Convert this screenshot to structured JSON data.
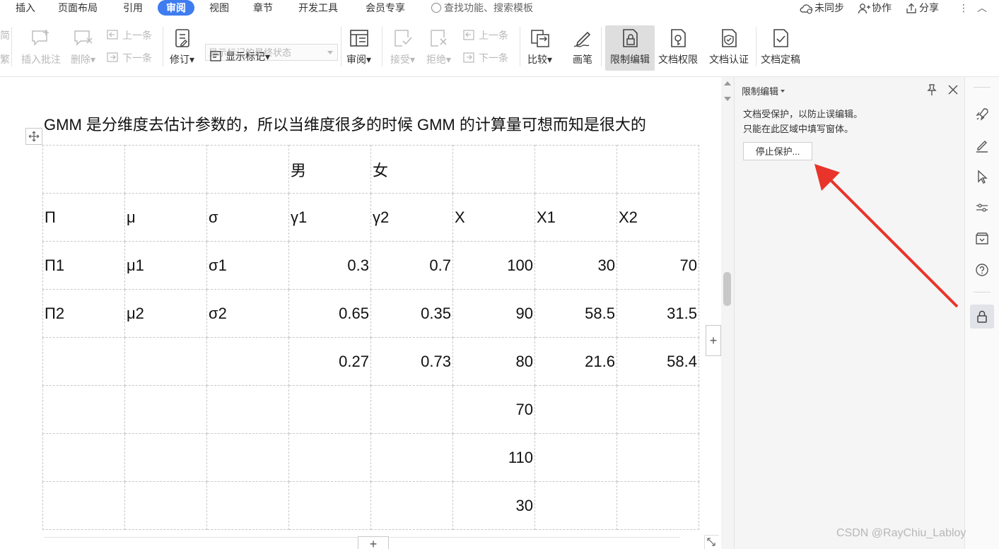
{
  "menu": {
    "tabs": [
      "插入",
      "页面布局",
      "引用",
      "审阅",
      "视图",
      "章节",
      "开发工具",
      "会员专享"
    ],
    "active_tab": "审阅",
    "search_placeholder": "查找功能、搜索模板",
    "sync_label": "未同步",
    "collab_label": "协作",
    "share_label": "分享",
    "more_label": "⋮",
    "collapse_label": "︿"
  },
  "ribbon": {
    "insert_comment": "插入批注",
    "delete": "删除",
    "prev": "上一条",
    "next": "下一条",
    "track": "修订",
    "markup_state": "显示标记的最终状态",
    "show_markup": "显示标记",
    "review": "审阅",
    "accept": "接受",
    "reject": "拒绝",
    "prev2": "上一条",
    "next2": "下一条",
    "compare": "比较",
    "pen": "画笔",
    "restrict_edit": "限制编辑",
    "doc_permission": "文档权限",
    "doc_cert": "文档认证",
    "doc_final": "文档定稿",
    "cut_left_top": "简",
    "cut_left_bottom": "繁"
  },
  "document": {
    "paragraph": "GMM 是分维度去估计参数的，所以当维度很多的时候 GMM 的计算量可想而知是很大的",
    "table": [
      [
        "",
        "",
        "",
        "男",
        "女",
        "",
        "",
        ""
      ],
      [
        "Π",
        "μ",
        "σ",
        "γ1",
        "γ2",
        "X",
        "X1",
        "X2"
      ],
      [
        "Π1",
        "μ1",
        "σ1",
        "0.3",
        "0.7",
        "100",
        "30",
        "70"
      ],
      [
        "Π2",
        "μ2",
        "σ2",
        "0.65",
        "0.35",
        "90",
        "58.5",
        "31.5"
      ],
      [
        "",
        "",
        "",
        "0.27",
        "0.73",
        "80",
        "21.6",
        "58.4"
      ],
      [
        "",
        "",
        "",
        "",
        "",
        "70",
        "",
        ""
      ],
      [
        "",
        "",
        "",
        "",
        "",
        "110",
        "",
        ""
      ],
      [
        "",
        "",
        "",
        "",
        "",
        "30",
        "",
        ""
      ]
    ],
    "add_symbol": "+"
  },
  "panel": {
    "title": "限制编辑",
    "line1": "文档受保护，以防止误编辑。",
    "line2": "只能在此区域中填写窗体。",
    "stop_button": "停止保护..."
  },
  "watermark": "CSDN @RayChiu_Labloy",
  "colors": {
    "accent": "#3e7cf0",
    "arrow": "#e8342a"
  }
}
